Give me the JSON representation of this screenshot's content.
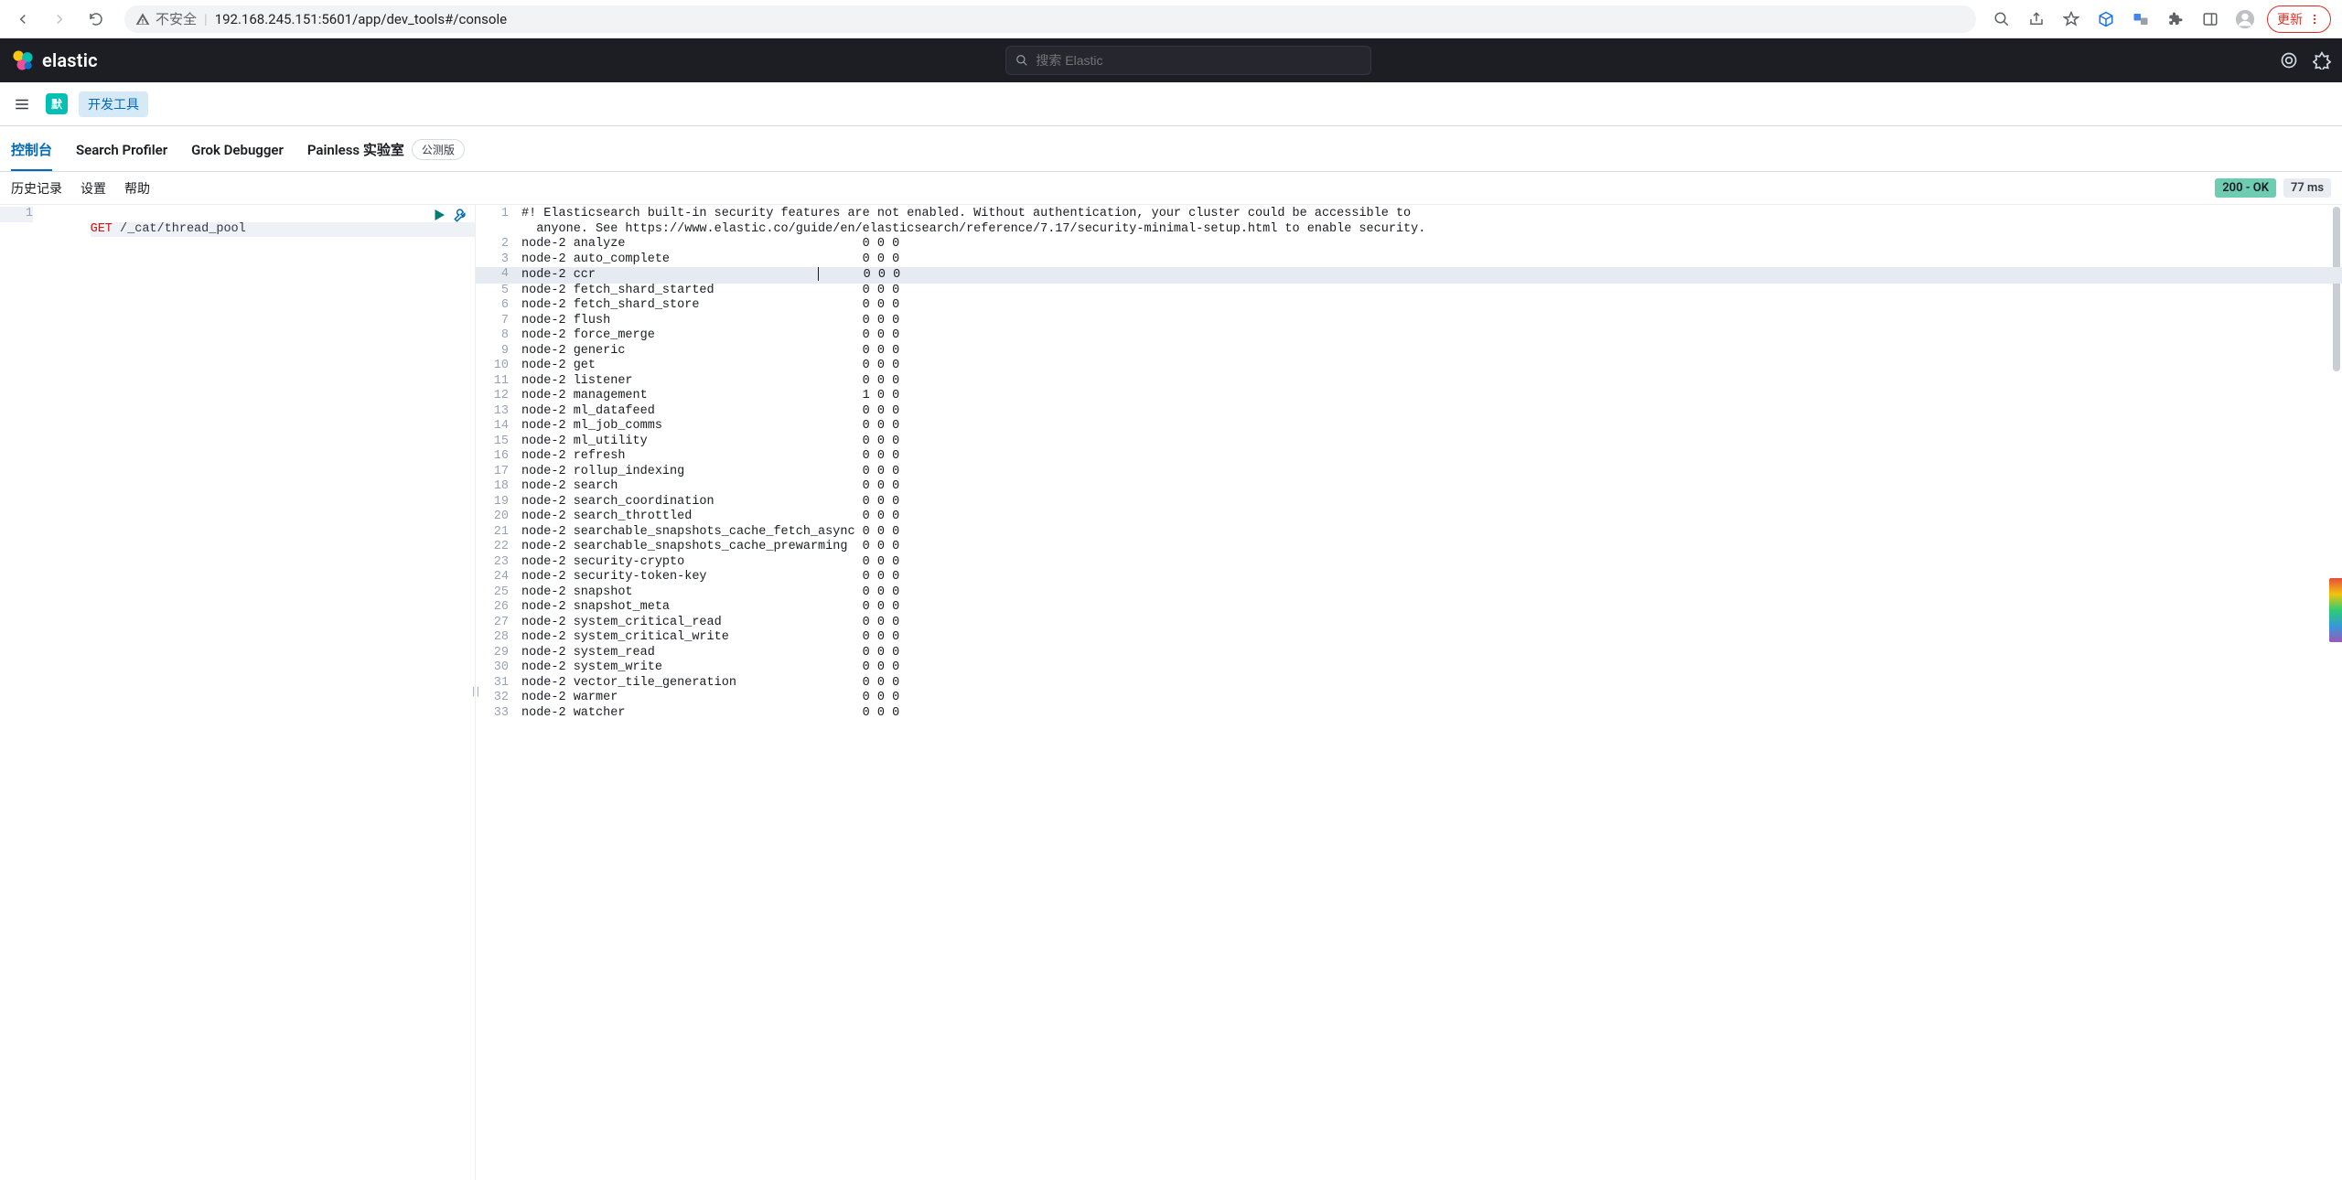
{
  "browser": {
    "insecure_label": "不安全",
    "url": "192.168.245.151:5601/app/dev_tools#/console",
    "update_label": "更新"
  },
  "kibana": {
    "brand": "elastic",
    "search_placeholder": "搜索 Elastic"
  },
  "subheader": {
    "default_badge": "默",
    "devtools_label": "开发工具"
  },
  "tabs": {
    "console": "控制台",
    "search_profiler": "Search Profiler",
    "grok": "Grok Debugger",
    "painless": "Painless 实验室",
    "beta": "公测版"
  },
  "toolbar": {
    "history": "历史记录",
    "settings": "设置",
    "help": "帮助",
    "status": "200 - OK",
    "time": "77 ms"
  },
  "request": {
    "method": "GET",
    "path": "/_cat/thread_pool"
  },
  "response": {
    "warning_line1": "#! Elasticsearch built-in security features are not enabled. Without authentication, your cluster could be accessible to",
    "warning_line2": "anyone. See https://www.elastic.co/guide/en/elasticsearch/reference/7.17/security-minimal-setup.html to enable security.",
    "highlight_index": 3,
    "rows": [
      {
        "node": "node-2",
        "pool": "analyze",
        "v": "0 0 0"
      },
      {
        "node": "node-2",
        "pool": "auto_complete",
        "v": "0 0 0"
      },
      {
        "node": "node-2",
        "pool": "ccr",
        "v": "0 0 0"
      },
      {
        "node": "node-2",
        "pool": "fetch_shard_started",
        "v": "0 0 0"
      },
      {
        "node": "node-2",
        "pool": "fetch_shard_store",
        "v": "0 0 0"
      },
      {
        "node": "node-2",
        "pool": "flush",
        "v": "0 0 0"
      },
      {
        "node": "node-2",
        "pool": "force_merge",
        "v": "0 0 0"
      },
      {
        "node": "node-2",
        "pool": "generic",
        "v": "0 0 0"
      },
      {
        "node": "node-2",
        "pool": "get",
        "v": "0 0 0"
      },
      {
        "node": "node-2",
        "pool": "listener",
        "v": "0 0 0"
      },
      {
        "node": "node-2",
        "pool": "management",
        "v": "1 0 0"
      },
      {
        "node": "node-2",
        "pool": "ml_datafeed",
        "v": "0 0 0"
      },
      {
        "node": "node-2",
        "pool": "ml_job_comms",
        "v": "0 0 0"
      },
      {
        "node": "node-2",
        "pool": "ml_utility",
        "v": "0 0 0"
      },
      {
        "node": "node-2",
        "pool": "refresh",
        "v": "0 0 0"
      },
      {
        "node": "node-2",
        "pool": "rollup_indexing",
        "v": "0 0 0"
      },
      {
        "node": "node-2",
        "pool": "search",
        "v": "0 0 0"
      },
      {
        "node": "node-2",
        "pool": "search_coordination",
        "v": "0 0 0"
      },
      {
        "node": "node-2",
        "pool": "search_throttled",
        "v": "0 0 0"
      },
      {
        "node": "node-2",
        "pool": "searchable_snapshots_cache_fetch_async",
        "v": "0 0 0"
      },
      {
        "node": "node-2",
        "pool": "searchable_snapshots_cache_prewarming",
        "v": "0 0 0"
      },
      {
        "node": "node-2",
        "pool": "security-crypto",
        "v": "0 0 0"
      },
      {
        "node": "node-2",
        "pool": "security-token-key",
        "v": "0 0 0"
      },
      {
        "node": "node-2",
        "pool": "snapshot",
        "v": "0 0 0"
      },
      {
        "node": "node-2",
        "pool": "snapshot_meta",
        "v": "0 0 0"
      },
      {
        "node": "node-2",
        "pool": "system_critical_read",
        "v": "0 0 0"
      },
      {
        "node": "node-2",
        "pool": "system_critical_write",
        "v": "0 0 0"
      },
      {
        "node": "node-2",
        "pool": "system_read",
        "v": "0 0 0"
      },
      {
        "node": "node-2",
        "pool": "system_write",
        "v": "0 0 0"
      },
      {
        "node": "node-2",
        "pool": "vector_tile_generation",
        "v": "0 0 0"
      },
      {
        "node": "node-2",
        "pool": "warmer",
        "v": "0 0 0"
      },
      {
        "node": "node-2",
        "pool": "watcher",
        "v": "0 0 0"
      }
    ]
  }
}
